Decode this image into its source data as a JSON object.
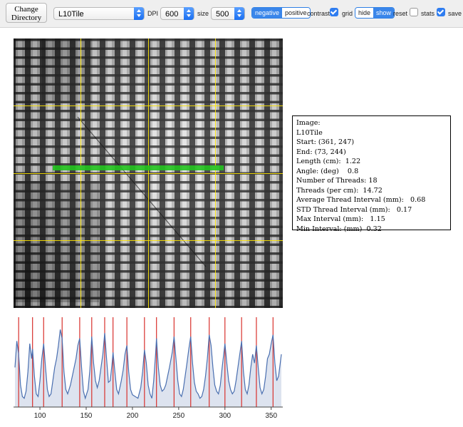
{
  "toolbar": {
    "change_directory_label": "Change Directory",
    "file_select_value": "L10Tile",
    "dpi_label": "DPI",
    "dpi_value": "600",
    "size_label": "size",
    "size_value": "500",
    "polarity_options": [
      "negative",
      "positive"
    ],
    "polarity_selected": "negative",
    "contrast_label": "contrast",
    "contrast_checked": true,
    "grid_label": "grid",
    "grid_options": [
      "hide",
      "show"
    ],
    "grid_selected": "show",
    "reset_label": "reset",
    "stats_checked": false,
    "stats_label": "stats",
    "save_checked": true,
    "save_label": "save",
    "accent_color": "#3a86ea"
  },
  "stats_panel": {
    "lines": [
      "Image:",
      "L10Tile",
      "Start: (361, 247)",
      "End: (73, 244)",
      "Length (cm):  1.22",
      "Angle: (deg)    0.8",
      "Number of Threads: 18",
      "Threads (per cm):  14.72",
      "Average Thread Interval (mm):   0.68",
      "STD Thread Interval (mm):   0.17",
      "Max Interval (mm):   1.15",
      "Min Interval: (mm)  0.32"
    ]
  },
  "measure_line_color": "#22c21e",
  "grid_color": "#ffe600",
  "chart_data": {
    "type": "line",
    "x_ticks": [
      100,
      150,
      200,
      250,
      300,
      350
    ],
    "xlim": [
      73,
      361
    ],
    "ylim": [
      0,
      1
    ],
    "line_color": "#4a6fb0",
    "fill_color": "#dde3ef",
    "peak_marker_color": "#d8302c",
    "peak_positions": [
      77,
      92,
      104,
      124,
      143,
      156,
      170,
      179,
      194,
      213,
      226,
      245,
      263,
      283,
      300,
      318,
      334,
      352
    ],
    "series": [
      {
        "x": [
          73,
          75,
          77,
          79,
          81,
          83,
          85,
          87,
          89,
          91,
          92,
          94,
          96,
          98,
          100,
          102,
          104,
          106,
          108,
          110,
          112,
          114,
          116,
          118,
          120,
          122,
          124,
          126,
          128,
          130,
          133,
          136,
          139,
          141,
          143,
          145,
          147,
          149,
          152,
          154,
          156,
          158,
          160,
          162,
          164,
          166,
          168,
          170,
          172,
          174,
          176,
          178,
          179,
          181,
          183,
          185,
          188,
          190,
          192,
          194,
          196,
          198,
          200,
          203,
          206,
          209,
          211,
          213,
          215,
          217,
          219,
          221,
          223,
          225,
          226,
          228,
          230,
          232,
          234,
          236,
          238,
          240,
          243,
          245,
          247,
          249,
          251,
          253,
          255,
          257,
          259,
          261,
          263,
          265,
          267,
          269,
          271,
          273,
          275,
          277,
          279,
          281,
          283,
          285,
          287,
          289,
          291,
          293,
          295,
          297,
          300,
          302,
          304,
          306,
          308,
          310,
          312,
          314,
          316,
          318,
          320,
          322,
          324,
          326,
          328,
          330,
          332,
          334,
          336,
          338,
          340,
          342,
          344,
          346,
          348,
          350,
          352,
          354,
          356,
          358,
          361
        ],
        "values": [
          0.45,
          0.75,
          0.6,
          0.25,
          0.12,
          0.1,
          0.18,
          0.4,
          0.72,
          0.55,
          0.66,
          0.35,
          0.15,
          0.12,
          0.3,
          0.55,
          0.72,
          0.45,
          0.2,
          0.12,
          0.15,
          0.3,
          0.45,
          0.55,
          0.7,
          0.88,
          0.78,
          0.4,
          0.2,
          0.15,
          0.25,
          0.4,
          0.55,
          0.7,
          0.78,
          0.45,
          0.18,
          0.1,
          0.2,
          0.42,
          0.8,
          0.5,
          0.3,
          0.22,
          0.3,
          0.45,
          0.6,
          0.84,
          0.55,
          0.28,
          0.3,
          0.5,
          0.62,
          0.4,
          0.2,
          0.15,
          0.3,
          0.42,
          0.6,
          0.7,
          0.4,
          0.2,
          0.14,
          0.12,
          0.1,
          0.22,
          0.4,
          0.65,
          0.5,
          0.25,
          0.15,
          0.1,
          0.3,
          0.6,
          0.78,
          0.45,
          0.25,
          0.18,
          0.2,
          0.25,
          0.35,
          0.45,
          0.62,
          0.8,
          0.55,
          0.3,
          0.15,
          0.12,
          0.2,
          0.35,
          0.5,
          0.66,
          0.8,
          0.5,
          0.28,
          0.18,
          0.15,
          0.1,
          0.12,
          0.2,
          0.35,
          0.55,
          0.82,
          0.7,
          0.45,
          0.25,
          0.18,
          0.15,
          0.25,
          0.45,
          0.72,
          0.5,
          0.3,
          0.2,
          0.15,
          0.18,
          0.3,
          0.45,
          0.6,
          0.75,
          0.4,
          0.2,
          0.15,
          0.25,
          0.45,
          0.6,
          0.5,
          0.7,
          0.45,
          0.22,
          0.15,
          0.2,
          0.35,
          0.55,
          0.6,
          0.72,
          0.82,
          0.5,
          0.3,
          0.35,
          0.6
        ]
      }
    ]
  }
}
